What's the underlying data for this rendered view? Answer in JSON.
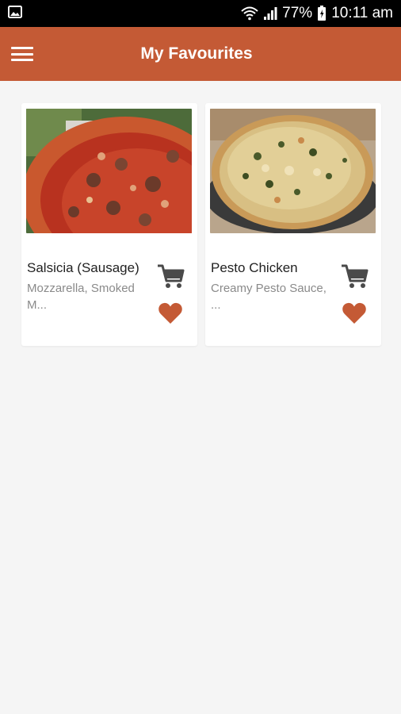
{
  "status_bar": {
    "battery": "77%",
    "time": "10:11 am",
    "icons": [
      "image-icon",
      "wifi-icon",
      "signal-icon",
      "battery-icon"
    ]
  },
  "app_bar": {
    "title": "My Favourites",
    "menu_icon": "hamburger-menu-icon"
  },
  "favourites": [
    {
      "name": "Salsicia (Sausage)",
      "description_line1": "Mozzarella, Smoked",
      "description_line2": "M...",
      "image": "sausage-pizza-photo"
    },
    {
      "name": "Pesto Chicken",
      "description_line1": "Creamy Pesto Sauce,",
      "description_line2": "...",
      "image": "pesto-chicken-pizza-photo"
    }
  ],
  "colors": {
    "accent": "#c45a35",
    "heart": "#c45a35",
    "cart": "#4a4a4a",
    "background": "#f5f5f5"
  }
}
